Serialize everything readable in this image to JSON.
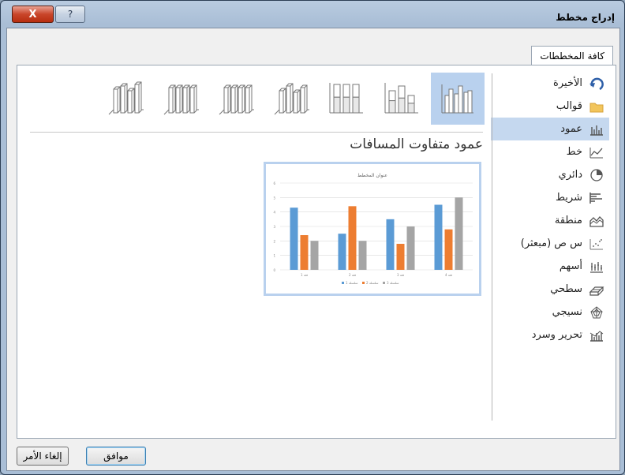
{
  "window": {
    "title": "إدراج مخطط",
    "close_symbol": "X",
    "help_symbol": "?"
  },
  "tabs": [
    {
      "label": "كافة المخططات"
    }
  ],
  "categories": [
    {
      "label": "الأخيرة",
      "icon": "recent-arrow-icon"
    },
    {
      "label": "قوالب",
      "icon": "folder-icon"
    },
    {
      "label": "عمود",
      "icon": "column-chart-icon",
      "selected": true
    },
    {
      "label": "خط",
      "icon": "line-chart-icon"
    },
    {
      "label": "دائري",
      "icon": "pie-chart-icon"
    },
    {
      "label": "شريط",
      "icon": "bar-chart-icon"
    },
    {
      "label": "منطقة",
      "icon": "area-chart-icon"
    },
    {
      "label": "س ص (مبعثر)",
      "icon": "scatter-chart-icon"
    },
    {
      "label": "أسهم",
      "icon": "stock-chart-icon"
    },
    {
      "label": "سطحي",
      "icon": "surface-chart-icon"
    },
    {
      "label": "نسيجي",
      "icon": "radar-chart-icon"
    },
    {
      "label": "تحرير وسرد",
      "icon": "combo-chart-icon"
    }
  ],
  "subtypes": [
    {
      "icon": "clustered-column-icon",
      "selected": true
    },
    {
      "icon": "stacked-column-icon"
    },
    {
      "icon": "100-stacked-column-icon"
    },
    {
      "icon": "3d-clustered-column-icon"
    },
    {
      "icon": "3d-stacked-column-icon"
    },
    {
      "icon": "3d-100-stacked-column-icon"
    },
    {
      "icon": "3d-column-icon"
    }
  ],
  "selected_chart_name": "عمود متفاوت المسافات",
  "preview": {
    "chart_data": {
      "type": "bar",
      "title": "عنوان المخطط",
      "categories": [
        "فئة 1",
        "فئة 2",
        "فئة 3",
        "فئة 4"
      ],
      "series": [
        {
          "values": [
            4.3,
            2.5,
            3.5,
            4.5
          ],
          "color": "#5b9bd5"
        },
        {
          "values": [
            2.4,
            4.4,
            1.8,
            2.8
          ],
          "color": "#ed7d31"
        },
        {
          "values": [
            2,
            2,
            3,
            5
          ],
          "color": "#a5a5a5"
        }
      ],
      "legend": [
        "سلسلة 1",
        "سلسلة 2",
        "سلسلة 3"
      ],
      "ylim": [
        0,
        6
      ],
      "yticks": [
        "0",
        "1",
        "2",
        "3",
        "4",
        "5",
        "6"
      ],
      "grid": true,
      "legend_position": "bottom"
    }
  },
  "buttons": {
    "ok": "موافق",
    "cancel": "إلغاء الأمر"
  }
}
